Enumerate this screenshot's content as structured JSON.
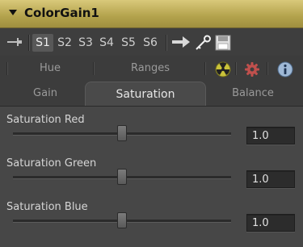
{
  "title": "ColorGain1",
  "toolbar": {
    "slots": [
      "S1",
      "S2",
      "S3",
      "S4",
      "S5",
      "S6"
    ],
    "active_slot": "S1"
  },
  "tabs_row1": {
    "labels": [
      "Hue",
      "Ranges"
    ]
  },
  "tabs_row2": {
    "labels": [
      "Gain",
      "Saturation",
      "Balance"
    ],
    "active": "Saturation"
  },
  "params": [
    {
      "label": "Saturation Red",
      "value": "1.0",
      "level": 0.5
    },
    {
      "label": "Saturation Green",
      "value": "1.0",
      "level": 0.5
    },
    {
      "label": "Saturation Blue",
      "value": "1.0",
      "level": 0.5
    }
  ],
  "colors": {
    "title_bar": "#c2b260",
    "panel_bg": "#474747",
    "radiation_icon": "#c9c23a",
    "gear_icon": "#c0504d",
    "info_icon": "#9fb9d6"
  },
  "icons": [
    "collapse-arrow-icon",
    "pin-icon",
    "arrow-right-icon",
    "key-icon",
    "save-icon",
    "radiation-icon",
    "gear-icon",
    "info-icon"
  ]
}
